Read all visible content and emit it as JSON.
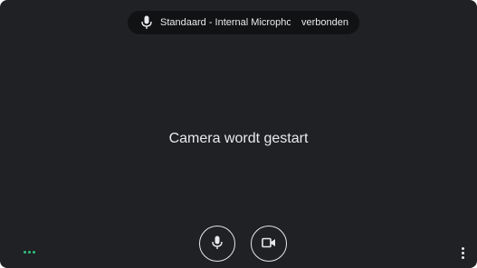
{
  "mic_indicator": {
    "icon": "microphone-icon",
    "device_name": "Standaard - Internal Micropho...",
    "status": "verbonden"
  },
  "preview": {
    "status_message": "Camera wordt gestart"
  },
  "controls": {
    "mic_icon": "microphone-icon",
    "camera_icon": "video-camera-icon",
    "more_icon": "more-vertical-icon",
    "audio_level_icon": "audio-level-dots-icon"
  },
  "colors": {
    "background": "#202124",
    "pill_background": "#111214",
    "text": "#e8eaed",
    "audio_level": "#2ec27e"
  }
}
